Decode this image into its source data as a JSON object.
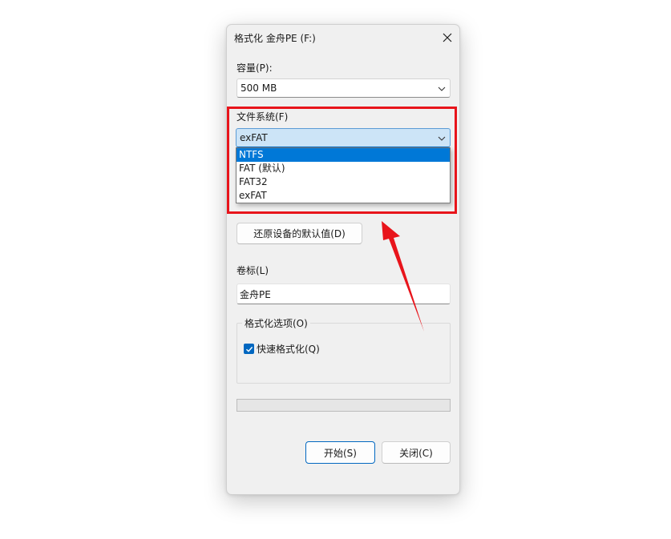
{
  "dialog": {
    "title": "格式化 金舟PE (F:)"
  },
  "capacity": {
    "label": "容量(P):",
    "value": "500 MB"
  },
  "file_system": {
    "label": "文件系统(F)",
    "value": "exFAT",
    "options": [
      "NTFS",
      "FAT (默认)",
      "FAT32",
      "exFAT"
    ],
    "highlighted_index": 0
  },
  "restore_defaults_label": "还原设备的默认值(D)",
  "volume_label": {
    "label": "卷标(L)",
    "value": "金舟PE"
  },
  "format_options": {
    "title": "格式化选项(O)",
    "quick_format_label": "快速格式化(Q)",
    "quick_format_checked": true
  },
  "progress": {
    "value": 0
  },
  "buttons": {
    "start": "开始(S)",
    "close": "关闭(C)"
  },
  "colors": {
    "annotation_red": "#e8141b",
    "accent_blue": "#0078d7"
  }
}
